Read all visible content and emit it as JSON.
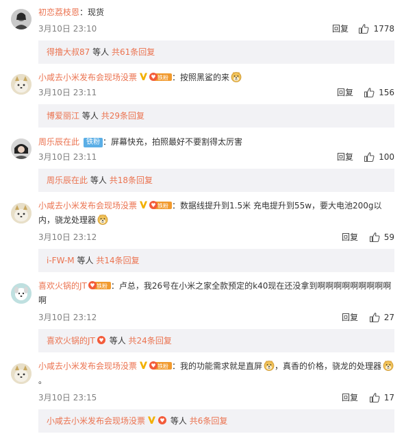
{
  "comments": [
    {
      "user": "初恋荔枝恩",
      "text": "现货",
      "time": "3月10日 23:10",
      "reply_label": "回复",
      "likes": "1778",
      "thread": {
        "name": "得撸大叔87",
        "etc": "等人",
        "count": "共61条回复"
      }
    },
    {
      "user": "小咸去小米发布会现场没票",
      "text": "按照黑鲨的来",
      "time": "3月10日 23:11",
      "reply_label": "回复",
      "likes": "156",
      "thread": {
        "name": "博爱丽江",
        "etc": "等人",
        "count": "共29条回复"
      }
    },
    {
      "user": "周乐辰在此",
      "fan_label": "铁粉",
      "text": "屏幕快充，拍照最好不要割得太厉害",
      "time": "3月10日 23:11",
      "reply_label": "回复",
      "likes": "100",
      "thread": {
        "name": "周乐辰在此",
        "etc": "等人",
        "count": "共18条回复"
      }
    },
    {
      "user": "小咸去小米发布会现场没票",
      "text": "数据线提升到1.5米 充电提升到55w，要大电池200g以内，骁龙处理器",
      "time": "3月10日 23:12",
      "reply_label": "回复",
      "likes": "59",
      "thread": {
        "name": "i-FW-M",
        "etc": "等人",
        "count": "共14条回复"
      }
    },
    {
      "user": "喜欢火锅的JT",
      "text": "卢总，我26号在小米之家全款预定的k40现在还没拿到啊啊啊啊啊啊啊啊啊啊",
      "time": "3月10日 23:12",
      "reply_label": "回复",
      "likes": "27",
      "thread": {
        "name": "喜欢火锅的JT",
        "etc": "等人",
        "count": "共24条回复"
      }
    },
    {
      "user": "小咸去小米发布会现场没票",
      "text_a": "我的功能需求就是直屏",
      "text_b": "，真香的价格，骁龙的处理器",
      "text_c": "。",
      "time": "3月10日 23:15",
      "reply_label": "回复",
      "likes": "17",
      "thread": {
        "name": "小咸去小米发布会现场没票",
        "etc": "等人",
        "count": "共6条回复"
      }
    }
  ],
  "badges": {
    "fan_text": "铁粉"
  },
  "colors": {
    "username": "#eb7350",
    "fan_pill": "#5aaee6",
    "thread_bg": "#f2f2f5"
  }
}
